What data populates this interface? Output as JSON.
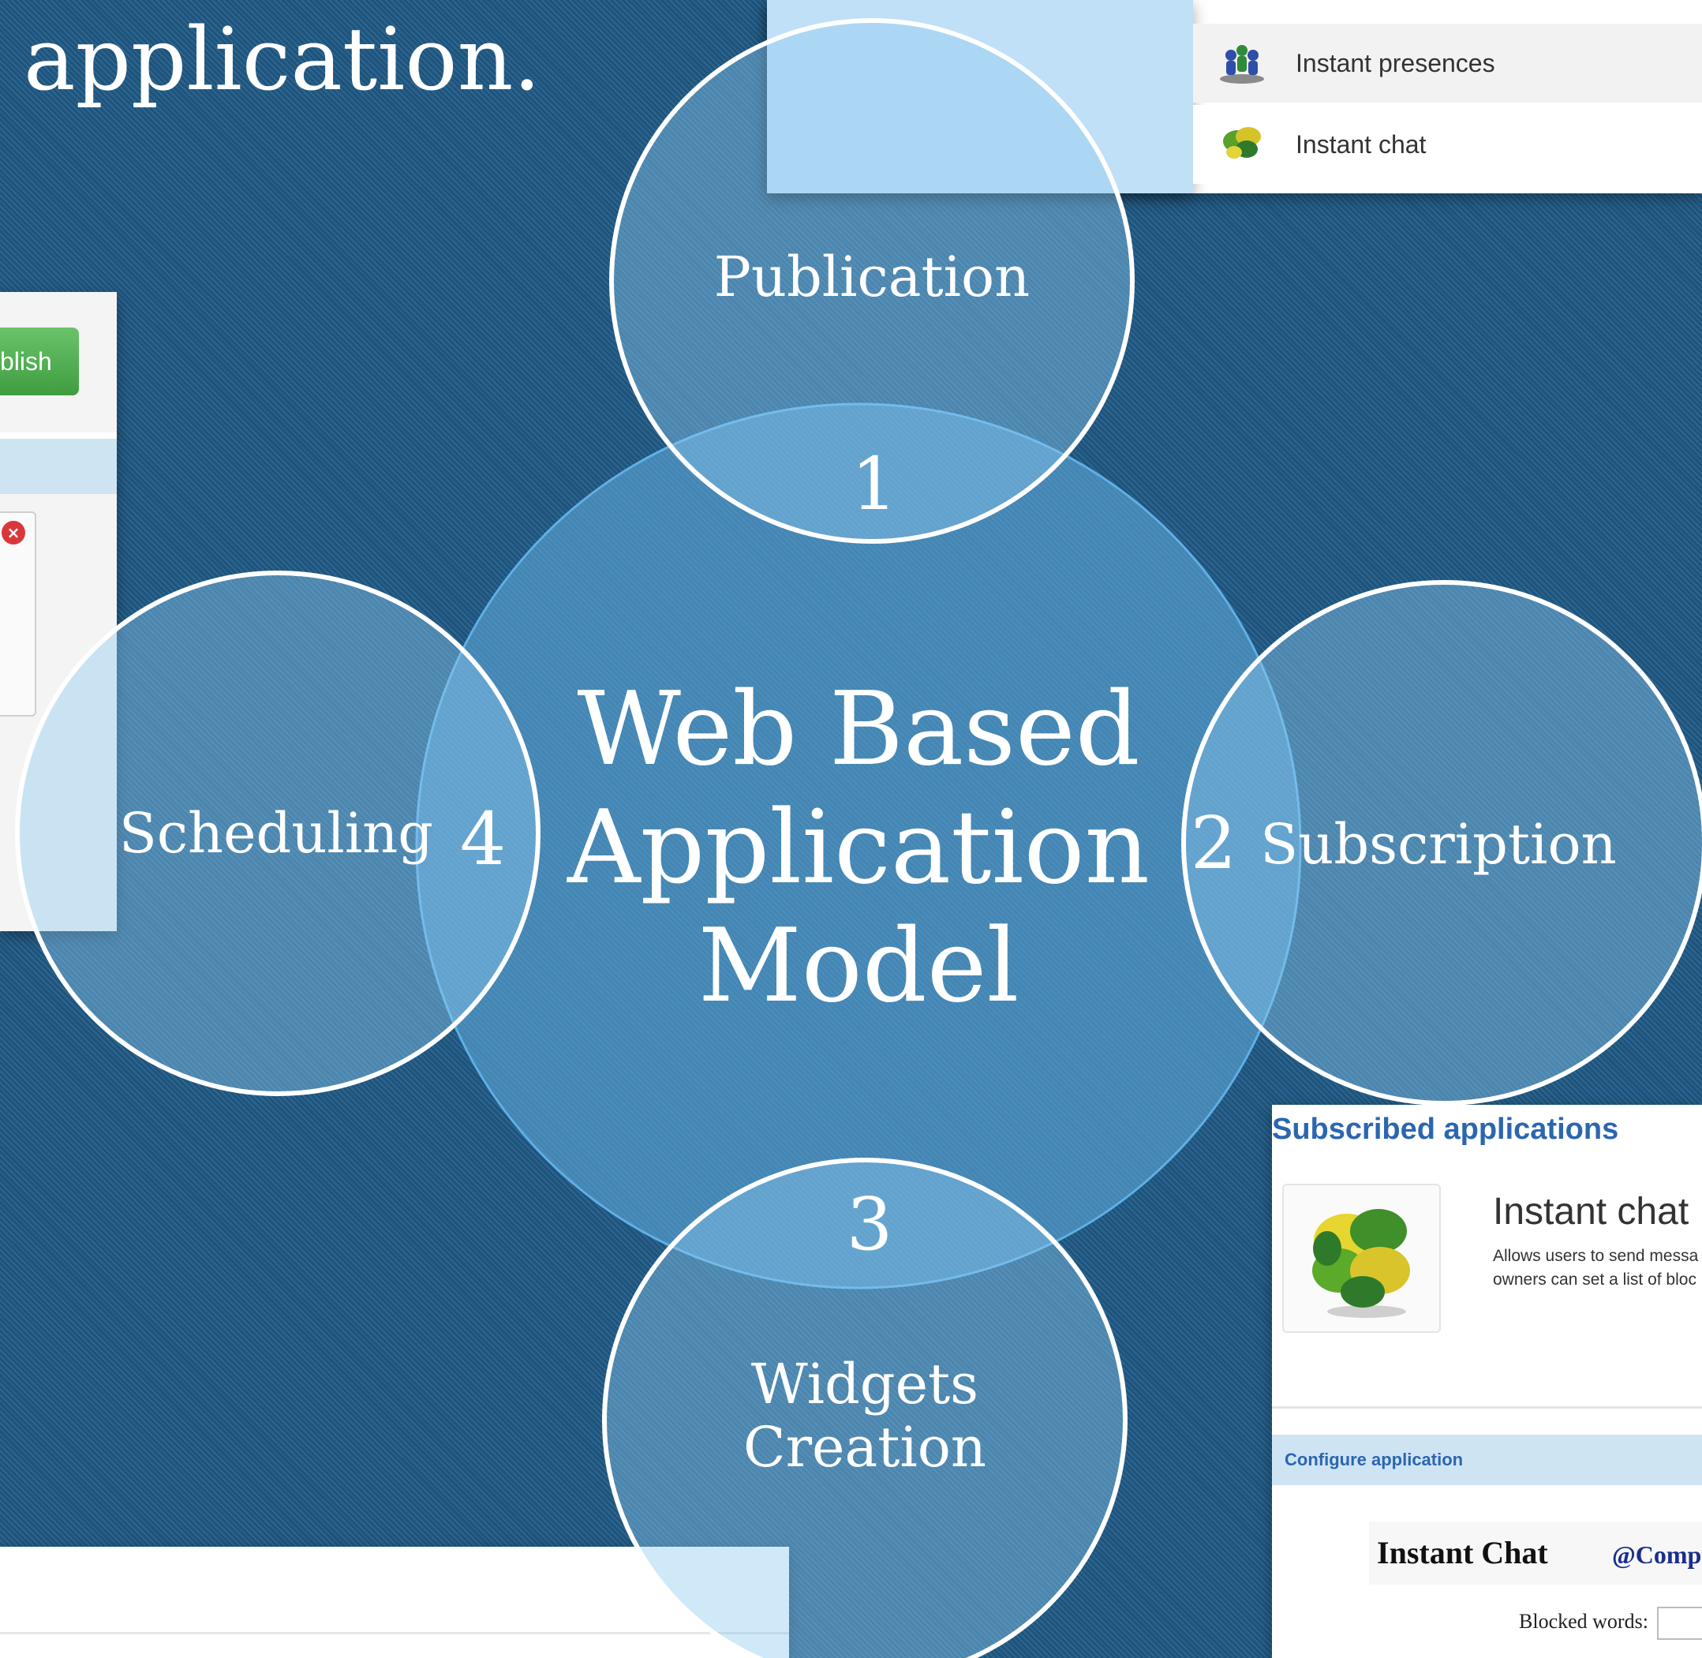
{
  "heading": "application.",
  "diagram": {
    "center": [
      "Web Based",
      "Application",
      "Model"
    ],
    "nodes": [
      {
        "number": "1",
        "label": "Publication"
      },
      {
        "number": "2",
        "label": "Subscription"
      },
      {
        "number": "3",
        "label_line1": "Widgets",
        "label_line2": "Creation"
      },
      {
        "number": "4",
        "label": "Scheduling"
      }
    ]
  },
  "background_screens": {
    "top_list": [
      "Instant presences",
      "Instant chat"
    ],
    "left_panel": {
      "button": "blish"
    },
    "subscribed": {
      "heading": "Subscribed applications",
      "app_name": "Instant chat",
      "desc_line1": "Allows users to send messa",
      "desc_line2": "owners can set a list of bloc",
      "configure": "Configure application",
      "widget_title": "Instant Chat",
      "widget_org": "@Compu",
      "blocked_label": "Blocked words:"
    }
  },
  "colors": {
    "background": "#1f5a86",
    "circle_fill": "#64aee0",
    "circle_stroke": "#ffffff",
    "accent_blue": "#2b66b0",
    "button_green": "#4caf50"
  }
}
